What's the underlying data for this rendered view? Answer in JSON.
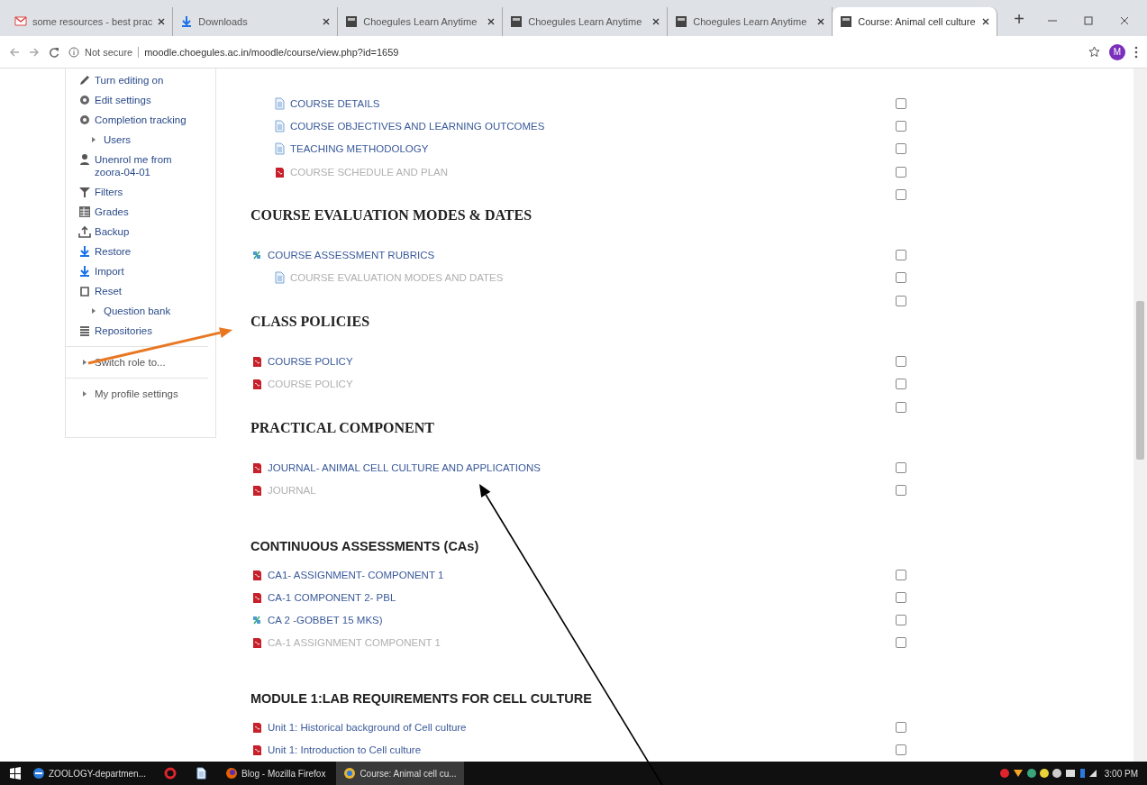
{
  "browser": {
    "tabs": [
      {
        "title": "some resources - best prac",
        "selected": false
      },
      {
        "title": "Downloads",
        "selected": false
      },
      {
        "title": "Choegules Learn Anytime",
        "selected": false
      },
      {
        "title": "Choegules Learn Anytime",
        "selected": false
      },
      {
        "title": "Choegules Learn Anytime",
        "selected": false
      },
      {
        "title": "Course: Animal cell culture",
        "selected": true
      }
    ],
    "new_tab": "+",
    "security": "Not secure",
    "url": "moodle.choegules.ac.in/moodle/course/view.php?id=1659",
    "profile_initial": "M"
  },
  "sidebar": {
    "items": [
      {
        "label": "Turn editing on"
      },
      {
        "label": "Edit settings"
      },
      {
        "label": "Completion tracking"
      },
      {
        "label": "Users"
      },
      {
        "label": "Unenrol me from zoora-04-01"
      },
      {
        "label": "Filters"
      },
      {
        "label": "Grades"
      },
      {
        "label": "Backup"
      },
      {
        "label": "Restore"
      },
      {
        "label": "Import"
      },
      {
        "label": "Reset"
      },
      {
        "label": "Question bank"
      },
      {
        "label": "Repositories"
      }
    ],
    "footer_items": [
      {
        "label": "Switch role to..."
      },
      {
        "label": "My profile settings"
      }
    ]
  },
  "sections": [
    {
      "items": [
        {
          "kind": "page",
          "label": "COURSE DETAILS",
          "hidden": false,
          "checked": false
        },
        {
          "kind": "page",
          "label": "COURSE OBJECTIVES AND LEARNING OUTCOMES",
          "hidden": false,
          "checked": false
        },
        {
          "kind": "page",
          "label": "TEACHING METHODOLOGY",
          "hidden": false,
          "checked": false
        },
        {
          "kind": "pdf",
          "label": "COURSE SCHEDULE AND PLAN",
          "hidden": true,
          "checked": false
        },
        {
          "kind": "blank",
          "checked": false
        }
      ]
    },
    {
      "title": "COURSE EVALUATION MODES & DATES",
      "kind": "serif",
      "items": [
        {
          "kind": "url",
          "label": "COURSE ASSESSMENT RUBRICS",
          "hidden": false,
          "checked": false
        },
        {
          "kind": "subpage",
          "label": "COURSE EVALUATION MODES AND DATES",
          "hidden": true,
          "checked": false
        },
        {
          "kind": "blank",
          "checked": false
        }
      ]
    },
    {
      "title": "CLASS POLICIES",
      "kind": "serif",
      "items": [
        {
          "kind": "pdf",
          "label": "COURSE POLICY",
          "hidden": false,
          "checked": false
        },
        {
          "kind": "pdf",
          "label": "COURSE POLICY",
          "hidden": true,
          "checked": false
        },
        {
          "kind": "blank",
          "checked": false
        }
      ]
    },
    {
      "title": "PRACTICAL COMPONENT",
      "kind": "serif",
      "items": [
        {
          "kind": "pdf",
          "label": "JOURNAL- ANIMAL CELL CULTURE AND APPLICATIONS",
          "hidden": false,
          "checked": false
        },
        {
          "kind": "pdf",
          "label": "JOURNAL",
          "hidden": true,
          "checked": false
        }
      ]
    },
    {
      "title": "CONTINUOUS ASSESSMENTS (CAs)",
      "kind": "sans",
      "items": [
        {
          "kind": "pdf",
          "label": "CA1- ASSIGNMENT- COMPONENT 1",
          "hidden": false,
          "checked": false
        },
        {
          "kind": "pdf",
          "label": "CA-1 COMPONENT 2- PBL",
          "hidden": false,
          "checked": false
        },
        {
          "kind": "url",
          "label": "CA 2 -GOBBET 15 MKS)",
          "hidden": false,
          "checked": false
        },
        {
          "kind": "pdf",
          "label": "CA-1 ASSIGNMENT COMPONENT 1",
          "hidden": true,
          "checked": false
        }
      ]
    },
    {
      "title": "MODULE 1:LAB REQUIREMENTS FOR CELL CULTURE",
      "kind": "sans",
      "items": [
        {
          "kind": "pdf",
          "label": "Unit 1: Historical background of Cell culture",
          "hidden": false,
          "checked": false
        },
        {
          "kind": "pdf",
          "label": "Unit 1: Introduction to Cell culture",
          "hidden": false,
          "checked": false
        }
      ]
    }
  ],
  "taskbar": {
    "apps": [
      {
        "label": "ZOOLOGY-departmen...",
        "selected": false
      },
      {
        "selected": false
      },
      {
        "selected": false
      },
      {
        "label": "Blog - Mozilla Firefox",
        "selected": false
      },
      {
        "label": "Course: Animal cell cu...",
        "selected": true
      }
    ],
    "time": "3:00 PM"
  },
  "annotation_arrows": [
    {
      "color": "#e87722"
    },
    {
      "color": "#000000"
    }
  ]
}
